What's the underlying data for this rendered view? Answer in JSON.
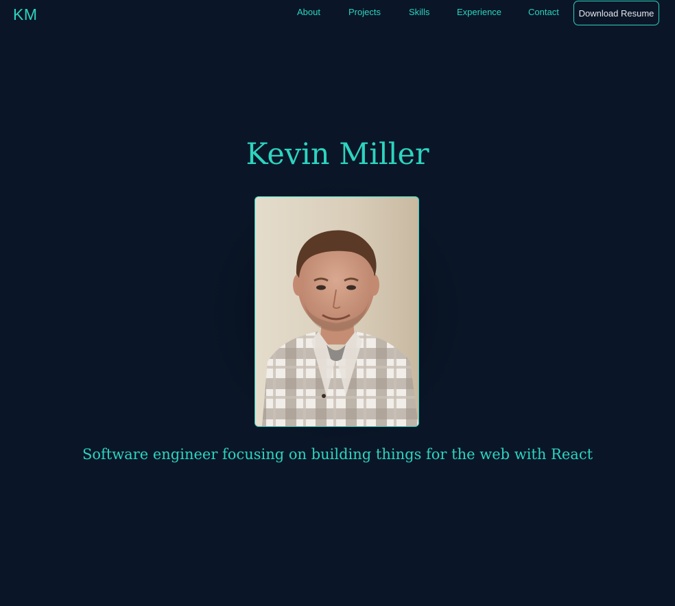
{
  "brand": {
    "logo": "KM"
  },
  "nav": {
    "items": [
      {
        "label": "About"
      },
      {
        "label": "Projects"
      },
      {
        "label": "Skills"
      },
      {
        "label": "Experience"
      },
      {
        "label": "Contact"
      }
    ],
    "resume_button": "Download Resume"
  },
  "hero": {
    "name": "Kevin Miller",
    "photo_icon": "profile-photo",
    "tagline": "Software engineer focusing on building things for the web with React"
  },
  "colors": {
    "background": "#0a1628",
    "accent": "#2dd4bf",
    "button_text": "#e5e7eb"
  }
}
